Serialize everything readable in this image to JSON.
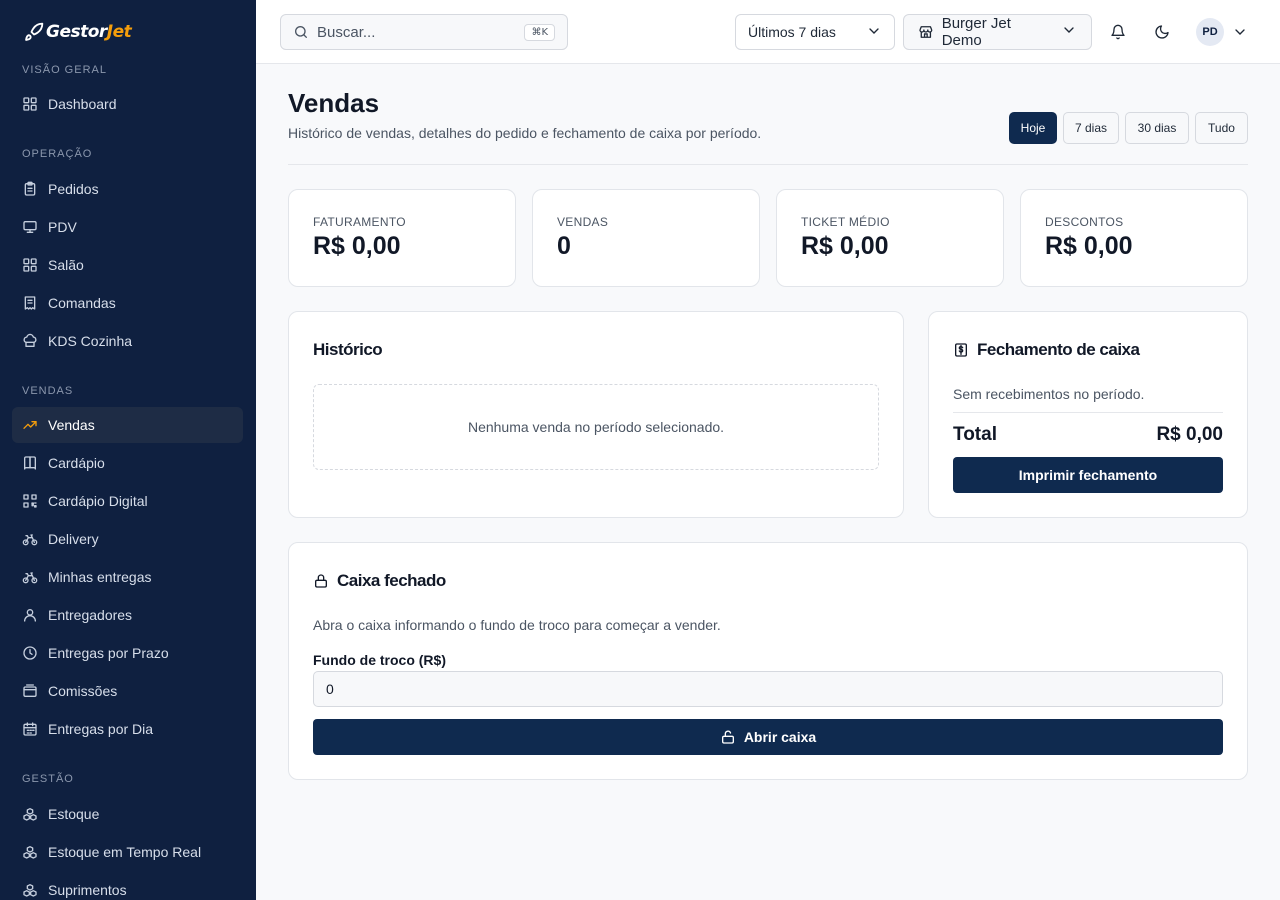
{
  "logo": {
    "text_main": "Gestor",
    "text_accent": "Jet"
  },
  "sidebar": {
    "sections": [
      {
        "label": "VISÃO GERAL",
        "items": [
          {
            "label": "Dashboard",
            "icon": "grid-icon"
          }
        ]
      },
      {
        "label": "OPERAÇÃO",
        "items": [
          {
            "label": "Pedidos",
            "icon": "clipboard-icon"
          },
          {
            "label": "PDV",
            "icon": "monitor-icon"
          },
          {
            "label": "Salão",
            "icon": "grid-icon"
          },
          {
            "label": "Comandas",
            "icon": "receipt-icon"
          },
          {
            "label": "KDS Cozinha",
            "icon": "chef-hat-icon"
          }
        ]
      },
      {
        "label": "VENDAS",
        "items": [
          {
            "label": "Vendas",
            "icon": "trending-up-icon",
            "active": true
          },
          {
            "label": "Cardápio",
            "icon": "book-icon"
          },
          {
            "label": "Cardápio Digital",
            "icon": "qr-code-icon"
          },
          {
            "label": "Delivery",
            "icon": "bike-icon"
          },
          {
            "label": "Minhas entregas",
            "icon": "bike-icon"
          },
          {
            "label": "Entregadores",
            "icon": "user-icon"
          },
          {
            "label": "Entregas por Prazo",
            "icon": "clock-icon"
          },
          {
            "label": "Comissões",
            "icon": "wallet-icon"
          },
          {
            "label": "Entregas por Dia",
            "icon": "calendar-icon"
          }
        ]
      },
      {
        "label": "GESTÃO",
        "items": [
          {
            "label": "Estoque",
            "icon": "boxes-icon"
          },
          {
            "label": "Estoque em Tempo Real",
            "icon": "boxes-icon"
          },
          {
            "label": "Suprimentos",
            "icon": "boxes-icon"
          }
        ]
      }
    ]
  },
  "topbar": {
    "search_placeholder": "Buscar...",
    "search_shortcut": "⌘K",
    "period_select": "Últimos 7 dias",
    "store_select": "Burger Jet Demo",
    "avatar_initials": "PD"
  },
  "page": {
    "title": "Vendas",
    "subtitle": "Histórico de vendas, detalhes do pedido e fechamento de caixa por período.",
    "ranges": [
      {
        "label": "Hoje",
        "active": true
      },
      {
        "label": "7 dias",
        "active": false
      },
      {
        "label": "30 dias",
        "active": false
      },
      {
        "label": "Tudo",
        "active": false
      }
    ]
  },
  "kpis": [
    {
      "label": "FATURAMENTO",
      "value": "R$ 0,00"
    },
    {
      "label": "VENDAS",
      "value": "0"
    },
    {
      "label": "TICKET MÉDIO",
      "value": "R$ 0,00"
    },
    {
      "label": "DESCONTOS",
      "value": "R$ 0,00"
    }
  ],
  "history": {
    "title": "Histórico",
    "empty_message": "Nenhuma venda no período selecionado."
  },
  "closing": {
    "title": "Fechamento de caixa",
    "note": "Sem recebimentos no período.",
    "total_label": "Total",
    "total_value": "R$ 0,00",
    "print_button": "Imprimir fechamento"
  },
  "register": {
    "title": "Caixa fechado",
    "note": "Abra o caixa informando o fundo de troco para começar a vender.",
    "field_label": "Fundo de troco (R$)",
    "field_value": "0",
    "open_button": "Abrir caixa"
  },
  "colors": {
    "sidebar_bg": "#0f2040",
    "primary": "#0f2a4f",
    "accent": "#f59e0b"
  }
}
